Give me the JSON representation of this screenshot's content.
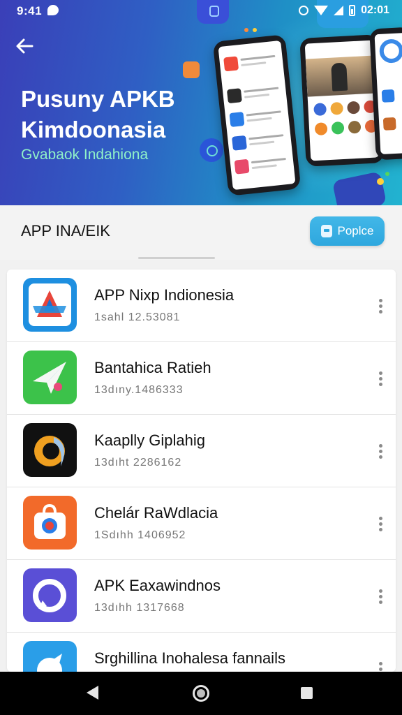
{
  "status_bar": {
    "time": "9:41",
    "clock": "02:01"
  },
  "hero": {
    "title_line1": "Pusuny APKB",
    "title_line2": "Kimdoonasia",
    "subtitle": "Gvabaok Indahiona"
  },
  "section": {
    "title": "APP INA/EIK",
    "popular_button_label": "Poplce"
  },
  "apps": [
    {
      "name": "APP Nixp Indionesia",
      "meta": "1sahl 12.53081"
    },
    {
      "name": "Bantahica Ratieh",
      "meta": "13dıny.1486333"
    },
    {
      "name": "Kaaplly Giplahig",
      "meta": "13dıht 2286162"
    },
    {
      "name": "Chelár RaWdlacia",
      "meta": "1Sdıhh 1406952"
    },
    {
      "name": "APK Eaxawindnos",
      "meta": "13dıhh 1317668"
    },
    {
      "name": "Srghillina Inohalesa fannails",
      "meta": ""
    }
  ],
  "colors": {
    "hero_gradient_start": "#3a3fb8",
    "hero_gradient_end": "#22b3d0",
    "subtitle_green": "#8ff0c8",
    "accent_blue": "#2ea7de"
  }
}
